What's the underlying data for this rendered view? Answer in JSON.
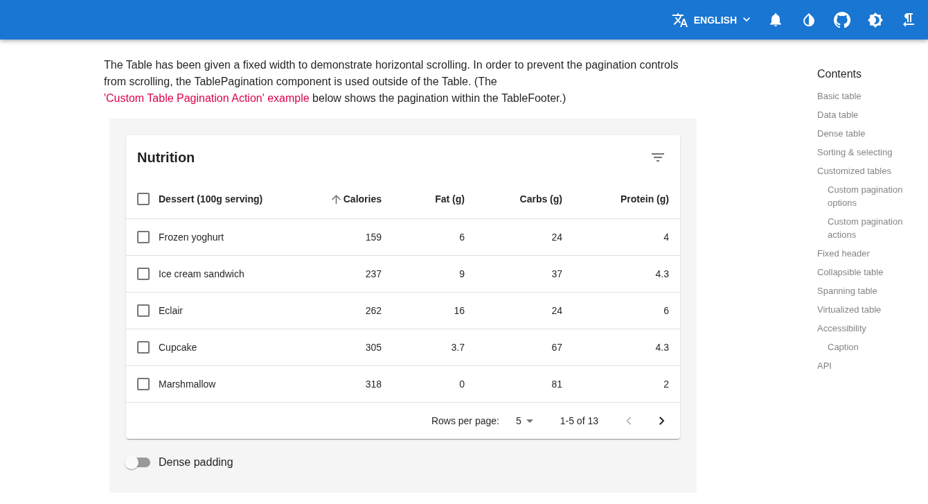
{
  "app_bar": {
    "language": "ENGLISH"
  },
  "intro": {
    "text": "The Table has been given a fixed width to demonstrate horizontal scrolling. In order to prevent the pagination controls from scrolling, the TablePagination component is used outside of the Table. (The",
    "link": "'Custom Table Pagination Action' example",
    "text_after": "below shows the pagination within the TableFooter.)"
  },
  "table": {
    "title": "Nutrition",
    "all_selected": false,
    "columns": [
      {
        "label": "Dessert (100g serving)",
        "sorted": false
      },
      {
        "label": "Calories",
        "sorted": true
      },
      {
        "label": "Fat (g)",
        "sorted": false
      },
      {
        "label": "Carbs (g)",
        "sorted": false
      },
      {
        "label": "Protein (g)",
        "sorted": false
      }
    ],
    "rows": [
      {
        "cells": [
          "Frozen yoghurt",
          "159",
          "6",
          "24",
          "4"
        ],
        "selected": false
      },
      {
        "cells": [
          "Ice cream sandwich",
          "237",
          "9",
          "37",
          "4.3"
        ],
        "selected": false
      },
      {
        "cells": [
          "Eclair",
          "262",
          "16",
          "24",
          "6"
        ],
        "selected": false
      },
      {
        "cells": [
          "Cupcake",
          "305",
          "3.7",
          "67",
          "4.3"
        ],
        "selected": false
      },
      {
        "cells": [
          "Marshmallow",
          "318",
          "0",
          "81",
          "2"
        ],
        "selected": false
      }
    ],
    "pagination": {
      "label": "Rows per page:",
      "rows_per_page": "5",
      "range": "1-5 of 13",
      "previous_disabled": true,
      "next_disabled": false
    }
  },
  "dense_padding": {
    "label": "Dense padding",
    "on": false
  },
  "contents": {
    "title": "Contents",
    "items": [
      {
        "label": "Basic table",
        "selected": false
      },
      {
        "label": "Data table",
        "selected": false
      },
      {
        "label": "Dense table",
        "selected": false
      },
      {
        "label": "Sorting & selecting",
        "selected": false
      },
      {
        "label": "Customized tables",
        "selected": false,
        "children": [
          {
            "label": "Custom pagination options",
            "selected": false
          },
          {
            "label": "Custom pagination actions",
            "selected": false
          }
        ]
      },
      {
        "label": "Fixed header",
        "selected": false
      },
      {
        "label": "Collapsible table",
        "selected": false
      },
      {
        "label": "Spanning table",
        "selected": false
      },
      {
        "label": "Virtualized table",
        "selected": false
      },
      {
        "label": "Accessibility",
        "selected": false,
        "children": [
          {
            "label": "Caption",
            "selected": false
          }
        ]
      },
      {
        "label": "API",
        "selected": false
      }
    ]
  }
}
